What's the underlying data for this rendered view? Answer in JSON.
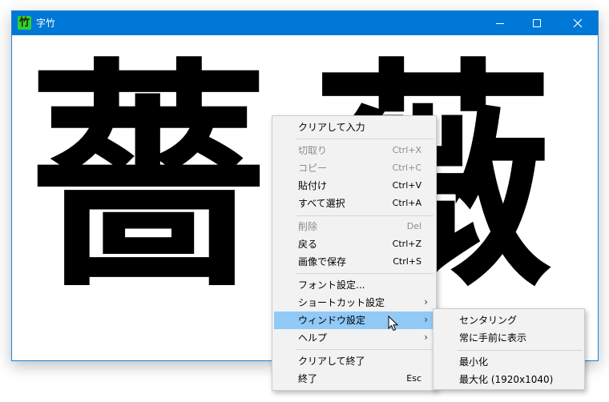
{
  "window": {
    "title": "字竹",
    "app_icon_glyph": "竹",
    "accent_color": "#0078d7"
  },
  "display": {
    "characters": [
      "薔",
      "薇"
    ]
  },
  "context_menu": {
    "items": [
      {
        "label": "クリアして入力",
        "shortcut": "",
        "enabled": true
      },
      {
        "label": "切取り",
        "shortcut": "Ctrl+X",
        "enabled": false
      },
      {
        "label": "コピー",
        "shortcut": "Ctrl+C",
        "enabled": false
      },
      {
        "label": "貼付け",
        "shortcut": "Ctrl+V",
        "enabled": true
      },
      {
        "label": "すべて選択",
        "shortcut": "Ctrl+A",
        "enabled": true
      },
      {
        "label": "削除",
        "shortcut": "Del",
        "enabled": false
      },
      {
        "label": "戻る",
        "shortcut": "Ctrl+Z",
        "enabled": true
      },
      {
        "label": "画像で保存",
        "shortcut": "Ctrl+S",
        "enabled": true
      },
      {
        "label": "フォント設定...",
        "shortcut": "",
        "enabled": true
      },
      {
        "label": "ショートカット設定",
        "shortcut": "",
        "enabled": true,
        "submenu": true
      },
      {
        "label": "ウィンドウ設定",
        "shortcut": "",
        "enabled": true,
        "submenu": true,
        "highlighted": true
      },
      {
        "label": "ヘルプ",
        "shortcut": "",
        "enabled": true,
        "submenu": true
      },
      {
        "label": "クリアして終了",
        "shortcut": "",
        "enabled": true
      },
      {
        "label": "終了",
        "shortcut": "Esc",
        "enabled": true
      }
    ],
    "highlight_color": "#91c9f7"
  },
  "submenu": {
    "items": [
      {
        "label": "センタリング"
      },
      {
        "label": "常に手前に表示"
      },
      {
        "label": "最小化"
      },
      {
        "label": "最大化 (1920x1040)"
      }
    ]
  }
}
